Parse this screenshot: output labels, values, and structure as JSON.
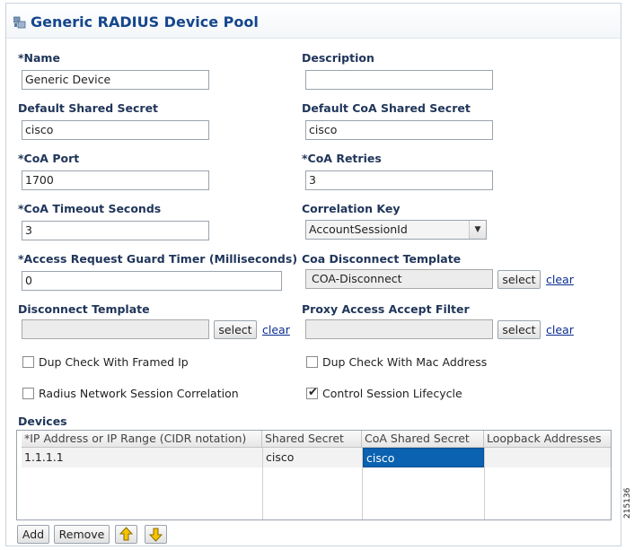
{
  "panel": {
    "title": "Generic RADIUS Device Pool"
  },
  "fields": {
    "name": {
      "label": "*Name",
      "value": "Generic Device"
    },
    "description": {
      "label": "Description",
      "value": ""
    },
    "default_shared_secret": {
      "label": "Default Shared Secret",
      "value": "cisco"
    },
    "default_coa_shared_secret": {
      "label": "Default CoA Shared Secret",
      "value": "cisco"
    },
    "coa_port": {
      "label": "*CoA Port",
      "value": "1700"
    },
    "coa_retries": {
      "label": "*CoA Retries",
      "value": "3"
    },
    "coa_timeout": {
      "label": "*CoA Timeout Seconds",
      "value": "3"
    },
    "correlation_key": {
      "label": "Correlation Key",
      "value": "AccountSessionId"
    },
    "guard_timer": {
      "label": "*Access Request Guard Timer (Milliseconds)",
      "value": "0"
    },
    "coa_disconnect_template": {
      "label": "Coa Disconnect Template",
      "value": "COA-Disconnect"
    },
    "disconnect_template": {
      "label": "Disconnect Template",
      "value": ""
    },
    "proxy_access_accept_filter": {
      "label": "Proxy Access Accept Filter",
      "value": ""
    }
  },
  "buttons": {
    "select": "select",
    "clear": "clear",
    "add": "Add",
    "remove": "Remove"
  },
  "checkboxes": {
    "dup_check_framed_ip": {
      "label": "Dup Check With Framed Ip",
      "checked": false
    },
    "dup_check_mac": {
      "label": "Dup Check With Mac Address",
      "checked": false
    },
    "radius_network_session": {
      "label": "Radius Network Session Correlation",
      "checked": false
    },
    "control_session_lifecycle": {
      "label": "Control Session Lifecycle",
      "checked": true,
      "mark": "✔"
    }
  },
  "devices": {
    "label": "Devices",
    "columns": [
      "*IP Address or IP Range (CIDR notation)",
      "Shared Secret",
      "CoA Shared Secret",
      "Loopback Addresses"
    ],
    "rows": [
      [
        "1.1.1.1",
        "cisco",
        "cisco",
        ""
      ]
    ]
  },
  "figure_code": "215136",
  "colors": {
    "title": "#15468c",
    "label": "#1f3559",
    "link": "#0b2c8f",
    "selection": "#0a62b0"
  }
}
